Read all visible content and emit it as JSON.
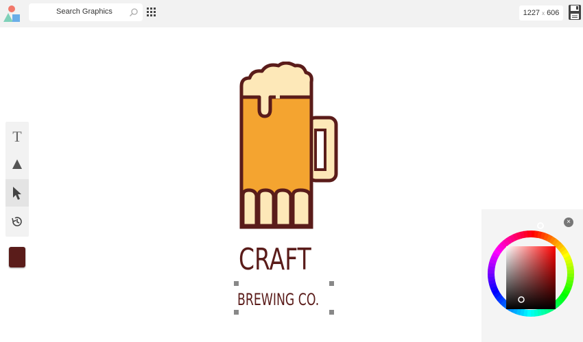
{
  "colors": {
    "accent_brown": "#5a1c1a",
    "beer": "#f4a430",
    "foam": "#fde8b8"
  },
  "topbar": {
    "logo_icon": "shapes-logo-icon",
    "search": {
      "placeholder": "Search Graphics",
      "icon": "search-icon"
    },
    "grid_icon": "grid-icon",
    "canvas_size": {
      "width": "1227",
      "separator": "x",
      "height": "606"
    },
    "save_icon": "floppy-disk-icon"
  },
  "toolbox": {
    "tools": [
      {
        "name": "text-tool",
        "label": "T",
        "icon": "text-icon"
      },
      {
        "name": "shape-tool",
        "icon": "triangle-icon"
      },
      {
        "name": "select-tool",
        "icon": "cursor-arrow-icon",
        "active": true
      },
      {
        "name": "history-tool",
        "icon": "history-clock-icon"
      }
    ],
    "current_color": "#5a1c1a"
  },
  "canvas": {
    "title": "CRAFT",
    "subtitle": "BREWING CO.",
    "graphic": "beer-mug-icon"
  },
  "color_picker": {
    "close_icon": "close-icon",
    "close_glyph": "×",
    "selected_hue": "#ff0000"
  }
}
